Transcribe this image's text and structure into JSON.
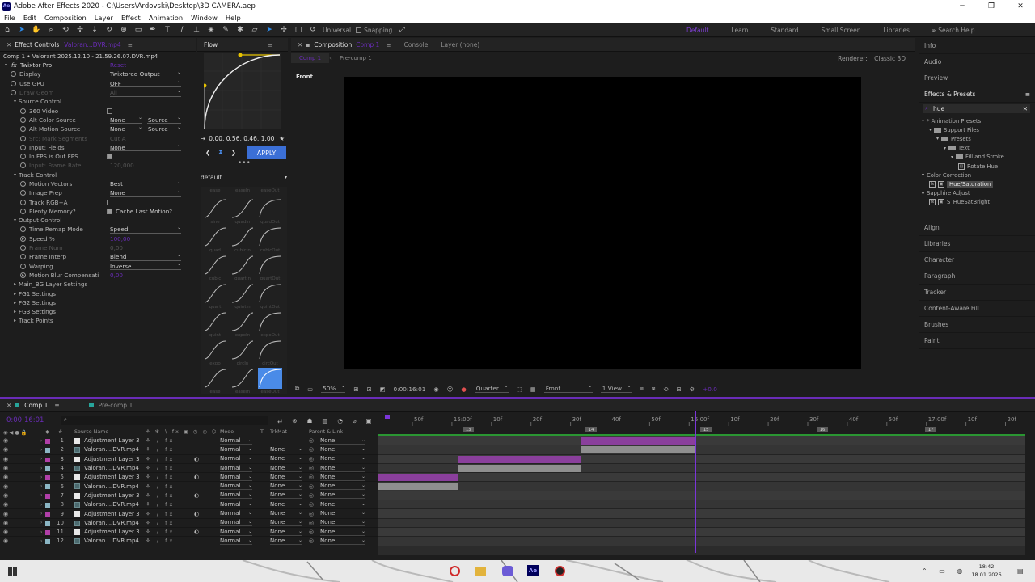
{
  "window": {
    "title": "Adobe After Effects 2020 - C:\\Users\\Ardovski\\Desktop\\3D CAMERA.aep",
    "controls": [
      "─",
      "❐",
      "✕"
    ]
  },
  "menu": [
    "File",
    "Edit",
    "Composition",
    "Layer",
    "Effect",
    "Animation",
    "Window",
    "Help"
  ],
  "toolbar": {
    "universal_label": "Universal",
    "snapping_label": "Snapping",
    "workspaces": [
      "Default",
      "Learn",
      "Standard",
      "Small Screen",
      "Libraries"
    ],
    "active_workspace": "Default",
    "search_placeholder": "Search Help"
  },
  "effect_controls": {
    "tab_label": "Effect Controls",
    "tab_layer": "Valoran...DVR.mp4",
    "subtitle": "Comp 1 • Valorant 2025.12.10 - 21.59.26.07.DVR.mp4",
    "effect_name": "Twixtor Pro",
    "effect_reset": "Reset",
    "rows": [
      {
        "label": "Display",
        "value": "Twixtored Output",
        "dropdown": true
      },
      {
        "label": "Use GPU",
        "value": "OFF",
        "dropdown": true
      },
      {
        "label": "Draw Geom",
        "value": "All",
        "dim": true,
        "dropdown": true
      },
      {
        "label": "Source Control",
        "section": true
      },
      {
        "label": "360 Video",
        "checkbox": true
      },
      {
        "label": "Alt Color Source",
        "value": "None",
        "value2": "Source"
      },
      {
        "label": "Alt Motion Source",
        "value": "None",
        "value2": "Source"
      },
      {
        "label": "Src: Mark Segments",
        "value": "Cut A",
        "dim": true
      },
      {
        "label": "Input: Fields",
        "value": "None",
        "dropdown": true
      },
      {
        "label": "In FPS is Out FPS",
        "checkbox": true,
        "checked": true
      },
      {
        "label": "Input: Frame Rate",
        "value": "120,000",
        "dim": true
      },
      {
        "label": "Track Control",
        "section": true
      },
      {
        "label": "Motion Vectors",
        "value": "Best",
        "dropdown": true
      },
      {
        "label": "Image Prep",
        "value": "None",
        "dropdown": true
      },
      {
        "label": "Track RGB+A",
        "checkbox": true
      },
      {
        "label": "Plenty Memory?",
        "checkbox": true,
        "checked": true,
        "value": "Cache Last Motion?"
      },
      {
        "label": "Output Control",
        "section": true
      },
      {
        "label": "Time Remap Mode",
        "value": "Speed",
        "dropdown": true
      },
      {
        "label": "Speed %",
        "value": "100,00",
        "purple": true
      },
      {
        "label": "Frame Num",
        "value": "0,00",
        "dim": true
      },
      {
        "label": "Frame Interp",
        "value": "Blend",
        "dropdown": true
      },
      {
        "label": "Warping",
        "value": "Inverse",
        "dropdown": true
      },
      {
        "label": "Motion Blur Compensati",
        "value": "0,00",
        "purple": true
      },
      {
        "label": "Main_BG Layer Settings",
        "group": true
      },
      {
        "label": "FG1 Settings",
        "group": true
      },
      {
        "label": "FG2 Settings",
        "group": true
      },
      {
        "label": "FG3 Settings",
        "group": true
      },
      {
        "label": "Track Points",
        "group": true
      }
    ]
  },
  "flow": {
    "tab_label": "Flow",
    "bezier_values": "0.00, 0.56, 0.46, 1.00",
    "apply_label": "APPLY",
    "preset_name": "default",
    "curve_captions": [
      "ease",
      "easeIn",
      "easeOut",
      "sine",
      "quadIn",
      "quadOut",
      "quad",
      "cubicIn",
      "cubicOut",
      "cubic",
      "quartIn",
      "quartOut",
      "quart",
      "quintIn",
      "quintOut",
      "quint",
      "expoIn",
      "expoOut",
      "expo",
      "circIn",
      "circOut"
    ]
  },
  "composition": {
    "tabs": [
      "Composition",
      "Console",
      "Layer (none)"
    ],
    "comp_name_tag": "Comp 1",
    "sub_tabs": [
      "Comp 1",
      "Pre-comp 1"
    ],
    "renderer_label": "Renderer:",
    "renderer_value": "Classic 3D",
    "view_label": "Front",
    "footer": {
      "zoom": "50%",
      "timecode": "0:00:16:01",
      "resolution": "Quarter",
      "view": "Front",
      "views": "1 View",
      "exposure": "+0.0"
    }
  },
  "right_panel": {
    "items_top": [
      "Info",
      "Audio",
      "Preview"
    ],
    "effects_label": "Effects & Presets",
    "search_value": "hue",
    "tree": [
      {
        "text": "* Animation Presets",
        "indent": 0,
        "type": "group"
      },
      {
        "text": "Support Files",
        "indent": 1,
        "type": "folder"
      },
      {
        "text": "Presets",
        "indent": 2,
        "type": "folder"
      },
      {
        "text": "Text",
        "indent": 3,
        "type": "folder"
      },
      {
        "text": "Fill and Stroke",
        "indent": 4,
        "type": "folder"
      },
      {
        "text": "Rotate Hue",
        "indent": 5,
        "type": "preset"
      },
      {
        "text": "Color Correction",
        "indent": 0,
        "type": "group"
      },
      {
        "text": "Hue/Saturation",
        "indent": 1,
        "type": "fx",
        "highlight": true
      },
      {
        "text": "Sapphire Adjust",
        "indent": 0,
        "type": "group"
      },
      {
        "text": "S_HueSatBright",
        "indent": 1,
        "type": "fx"
      }
    ],
    "items_bottom": [
      "Align",
      "Libraries",
      "Character",
      "Paragraph",
      "Tracker",
      "Content-Aware Fill",
      "Brushes",
      "Paint"
    ]
  },
  "timeline": {
    "tabs": [
      "Comp 1",
      "Pre-comp 1"
    ],
    "timecode": "0:00:16:01",
    "columns": [
      "Source Name",
      "Mode",
      "T",
      "TrkMat",
      "Parent & Link"
    ],
    "ruler_labels": [
      "50f",
      "15:00f",
      "10f",
      "20f",
      "30f",
      "40f",
      "50f",
      "16:00f",
      "10f",
      "20f",
      "30f",
      "40f",
      "50f",
      "17:00f",
      "10f",
      "20f"
    ],
    "markers": [
      "13",
      "14",
      "15",
      "16",
      "17"
    ],
    "layers": [
      {
        "n": "1",
        "name": "Adjustment Layer 3",
        "type": "adj",
        "color": "#b03fa8",
        "mode": "Normal",
        "trk": "",
        "parent": "None"
      },
      {
        "n": "2",
        "name": "Valoran....DVR.mp4",
        "type": "vid",
        "color": "#8bb6c4",
        "mode": "Normal",
        "trk": "None",
        "parent": "None"
      },
      {
        "n": "3",
        "name": "Adjustment Layer 3",
        "type": "adj",
        "color": "#b03fa8",
        "mode": "Normal",
        "trk": "None",
        "parent": "None"
      },
      {
        "n": "4",
        "name": "Valoran....DVR.mp4",
        "type": "vid",
        "color": "#8bb6c4",
        "mode": "Normal",
        "trk": "None",
        "parent": "None"
      },
      {
        "n": "5",
        "name": "Adjustment Layer 3",
        "type": "adj",
        "color": "#b03fa8",
        "mode": "Normal",
        "trk": "None",
        "parent": "None"
      },
      {
        "n": "6",
        "name": "Valoran....DVR.mp4",
        "type": "vid",
        "color": "#8bb6c4",
        "mode": "Normal",
        "trk": "None",
        "parent": "None"
      },
      {
        "n": "7",
        "name": "Adjustment Layer 3",
        "type": "adj",
        "color": "#b03fa8",
        "mode": "Normal",
        "trk": "None",
        "parent": "None"
      },
      {
        "n": "8",
        "name": "Valoran....DVR.mp4",
        "type": "vid",
        "color": "#8bb6c4",
        "mode": "Normal",
        "trk": "None",
        "parent": "None"
      },
      {
        "n": "9",
        "name": "Adjustment Layer 3",
        "type": "adj",
        "color": "#b03fa8",
        "mode": "Normal",
        "trk": "None",
        "parent": "None"
      },
      {
        "n": "10",
        "name": "Valoran....DVR.mp4",
        "type": "vid",
        "color": "#8bb6c4",
        "mode": "Normal",
        "trk": "None",
        "parent": "None"
      },
      {
        "n": "11",
        "name": "Adjustment Layer 3",
        "type": "adj",
        "color": "#b03fa8",
        "mode": "Normal",
        "trk": "None",
        "parent": "None"
      },
      {
        "n": "12",
        "name": "Valoran....DVR.mp4",
        "type": "vid",
        "color": "#8bb6c4",
        "mode": "Normal",
        "trk": "None",
        "parent": "None"
      }
    ]
  },
  "taskbar": {
    "time": "18:42",
    "date": "18.01.2026"
  }
}
